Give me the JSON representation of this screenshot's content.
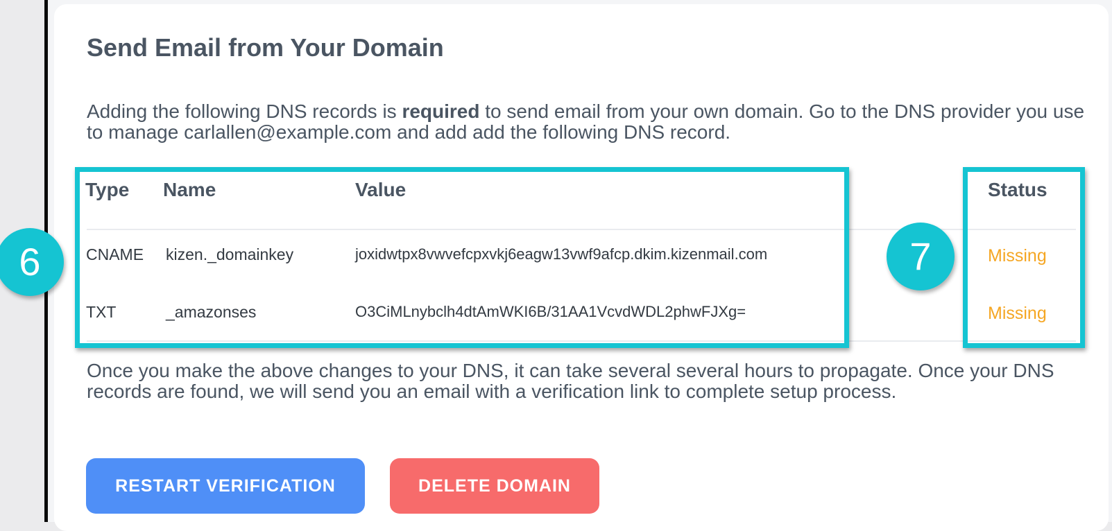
{
  "section": {
    "title": "Send Email from Your Domain",
    "intro_before": "Adding the following DNS records is ",
    "intro_bold": "required",
    "intro_after": " to send email from your own domain. Go to the DNS provider you use to manage carlallen@example.com and add add the following DNS record."
  },
  "table": {
    "headers": {
      "type": "Type",
      "name": "Name",
      "value": "Value",
      "status": "Status"
    },
    "rows": [
      {
        "type": "CNAME",
        "name": "kizen._domainkey",
        "value": "joxidwtpx8vwvefcpxvkj6eagw13vwf9afcp.dkim.kizenmail.com",
        "status": "Missing"
      },
      {
        "type": "TXT",
        "name": "_amazonses",
        "value": "O3CiMLnybclh4dtAmWKI6B/31AA1VcvdWDL2phwFJXg=",
        "status": "Missing"
      }
    ]
  },
  "callouts": {
    "left": "6",
    "right": "7"
  },
  "outro": "Once you make the above changes to your DNS, it can take several several hours to propagate. Once your DNS records are found, we will send you an email with a verification link to complete setup process.",
  "buttons": {
    "restart": "RESTART VERIFICATION",
    "delete": "DELETE DOMAIN"
  },
  "colors": {
    "accent_highlight": "#15c4d2",
    "status_missing": "#f5a623",
    "restart_button": "#4f8ff7",
    "delete_button": "#f76b6b"
  }
}
